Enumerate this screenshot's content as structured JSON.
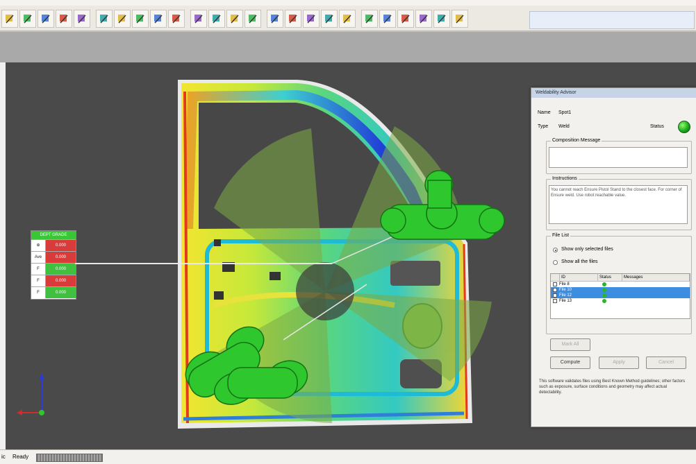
{
  "toolbar": {
    "icons": [
      "probe-icon",
      "folder-icon",
      "grid-icon",
      "cube-icon",
      "wand-icon",
      "axis-icon",
      "palette-icon",
      "cursor-icon",
      "point-icon",
      "measure-icon",
      "align-icon",
      "arrow-icon",
      "network-icon",
      "layers-icon",
      "pen-icon",
      "arrow-up-icon",
      "move-icon",
      "scale-icon",
      "chain-icon",
      "flag-icon",
      "lines-icon",
      "globe-icon",
      "sphere-icon",
      "camera-icon",
      "monitor-icon"
    ]
  },
  "legend": {
    "header": "DEPT GRADE",
    "rows": [
      {
        "symbol": "⊕",
        "value": "0.000",
        "color": "#d93b3b"
      },
      {
        "symbol": "Ave",
        "value": "0.000",
        "color": "#d93b3b"
      },
      {
        "symbol": "F",
        "value": "0.000",
        "color": "#3fc13f"
      },
      {
        "symbol": "F",
        "value": "0.000",
        "color": "#d93b3b"
      },
      {
        "symbol": "F",
        "value": "0.000",
        "color": "#3fc13f"
      }
    ]
  },
  "dialog": {
    "title": "Weldability Advisor",
    "name_label": "Name",
    "name_value": "Spot1",
    "type_label": "Type",
    "type_value": "Weld",
    "status_label": "Status",
    "composition_label": "Composition Message",
    "instructions_label": "Instructions",
    "instructions_text": "You cannot reach Ensure Pistol Stand to the closest face. For corner of Ensure weld. Use robot reachable value.",
    "filelist_label": "File List",
    "radio_selected": "Show only selected files",
    "radio_all": "Show all the files",
    "columns": [
      "ID",
      "Status",
      "Messages"
    ],
    "rows": [
      {
        "id": "File 8",
        "selected": false
      },
      {
        "id": "File 10",
        "selected": true
      },
      {
        "id": "File 12",
        "selected": true
      },
      {
        "id": "File 13",
        "selected": false
      }
    ],
    "btn_small": "Mark All",
    "btn_compute": "Compute",
    "btn_apply": "Apply",
    "btn_cancel": "Cancel",
    "footer_text": "This software validates files using Best Known Method guidelines; other factors such as exposure, surface conditions and geometry may affect actual detectability."
  },
  "statusbar": {
    "label1": "ic",
    "label2": "Ready"
  }
}
